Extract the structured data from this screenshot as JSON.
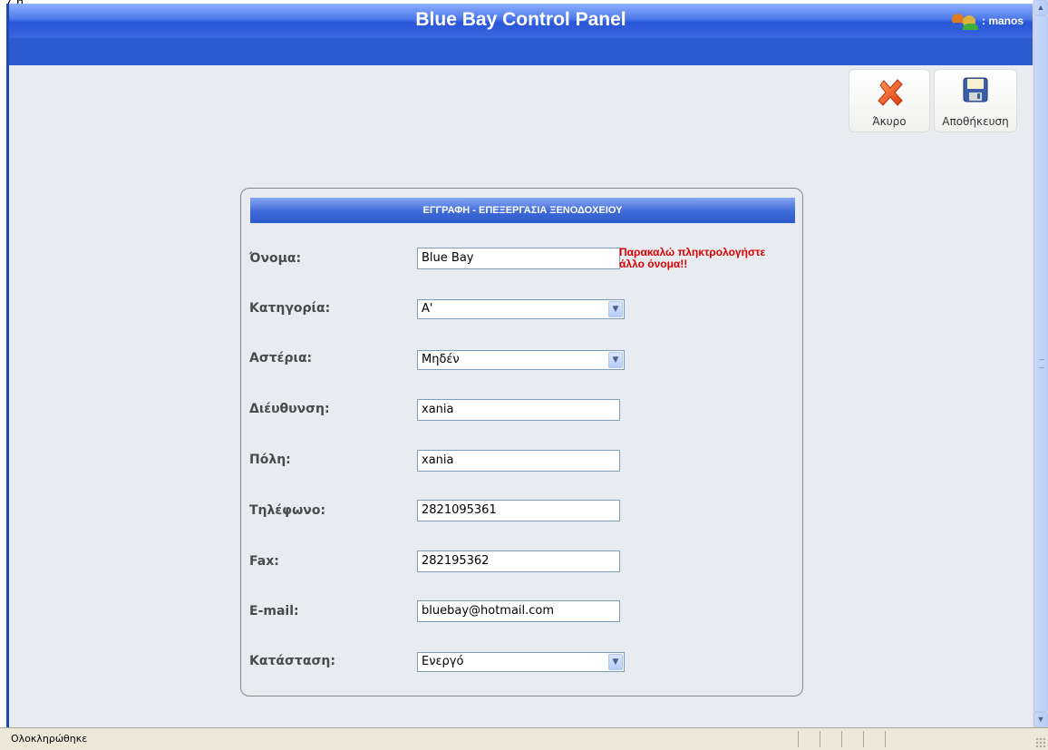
{
  "top_fragment": "ζ,η",
  "header": {
    "title": "Blue Bay Control Panel",
    "user": ": manos"
  },
  "toolbar": {
    "cancel_label": "Άκυρο",
    "save_label": "Αποθήκευση"
  },
  "form": {
    "title": "ΕΓΓΡΑΦΗ - ΕΠΕΞΕΡΓΑΣΙΑ ΞΕΝΟΔΟΧΕΙΟΥ",
    "name_label": "Όνομα:",
    "name_value": "Blue Bay",
    "name_error": "Παρακαλώ πληκτρολογήστε άλλο όνομα!!",
    "category_label": "Κατηγορία:",
    "category_value": "A'",
    "stars_label": "Αστέρια:",
    "stars_value": "Μηδέν",
    "address_label": "Διέυθυνση:",
    "address_value": "xania",
    "city_label": "Πόλη:",
    "city_value": "xania",
    "phone_label": "Τηλέφωνο:",
    "phone_value": "2821095361",
    "fax_label": "Fax:",
    "fax_value": "282195362",
    "email_label": "E-mail:",
    "email_value": "bluebay@hotmail.com",
    "status_label": "Κατάσταση:",
    "status_value": "Ενεργό"
  },
  "statusbar": {
    "text": "Ολοκληρώθηκε"
  },
  "colors": {
    "header_blue": "#2b5cd0",
    "error_red": "#dd0000",
    "content_bg": "#e8ecf0"
  }
}
